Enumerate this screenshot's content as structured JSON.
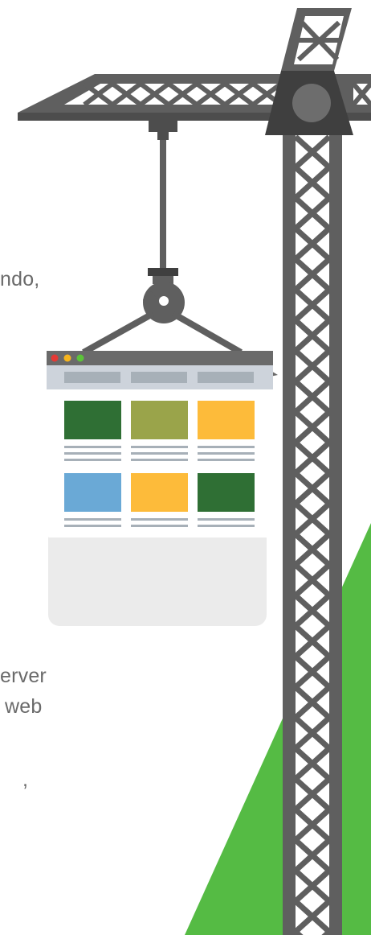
{
  "text_fragments": {
    "line_1": "ndo,",
    "line_2": "erver",
    "line_3": "web",
    "line_4": ","
  },
  "colors": {
    "crane": "#5f5f5f",
    "crane_dark": "#3f3f3f",
    "green_bg": "#55bb44",
    "window_bar": "#6a6a6a",
    "window_nav": "#cdd3db",
    "nav_item": "#a7b0b8",
    "tile_dark_green": "#2f6f34",
    "tile_olive": "#9aa44a",
    "tile_yellow": "#fdbb3a",
    "tile_blue": "#6aa9d6",
    "dot_red": "#e53935",
    "dot_yellow": "#f6b51e",
    "dot_green": "#5cc33a"
  },
  "browser_window": {
    "window_dots": [
      "close",
      "minimize",
      "maximize"
    ],
    "tiles_row_1": [
      "dark-green",
      "olive",
      "yellow"
    ],
    "tiles_row_2": [
      "blue",
      "yellow",
      "dark-green"
    ]
  },
  "icons": [
    "crane-illustration",
    "hook-icon",
    "browser-window-illustration"
  ]
}
